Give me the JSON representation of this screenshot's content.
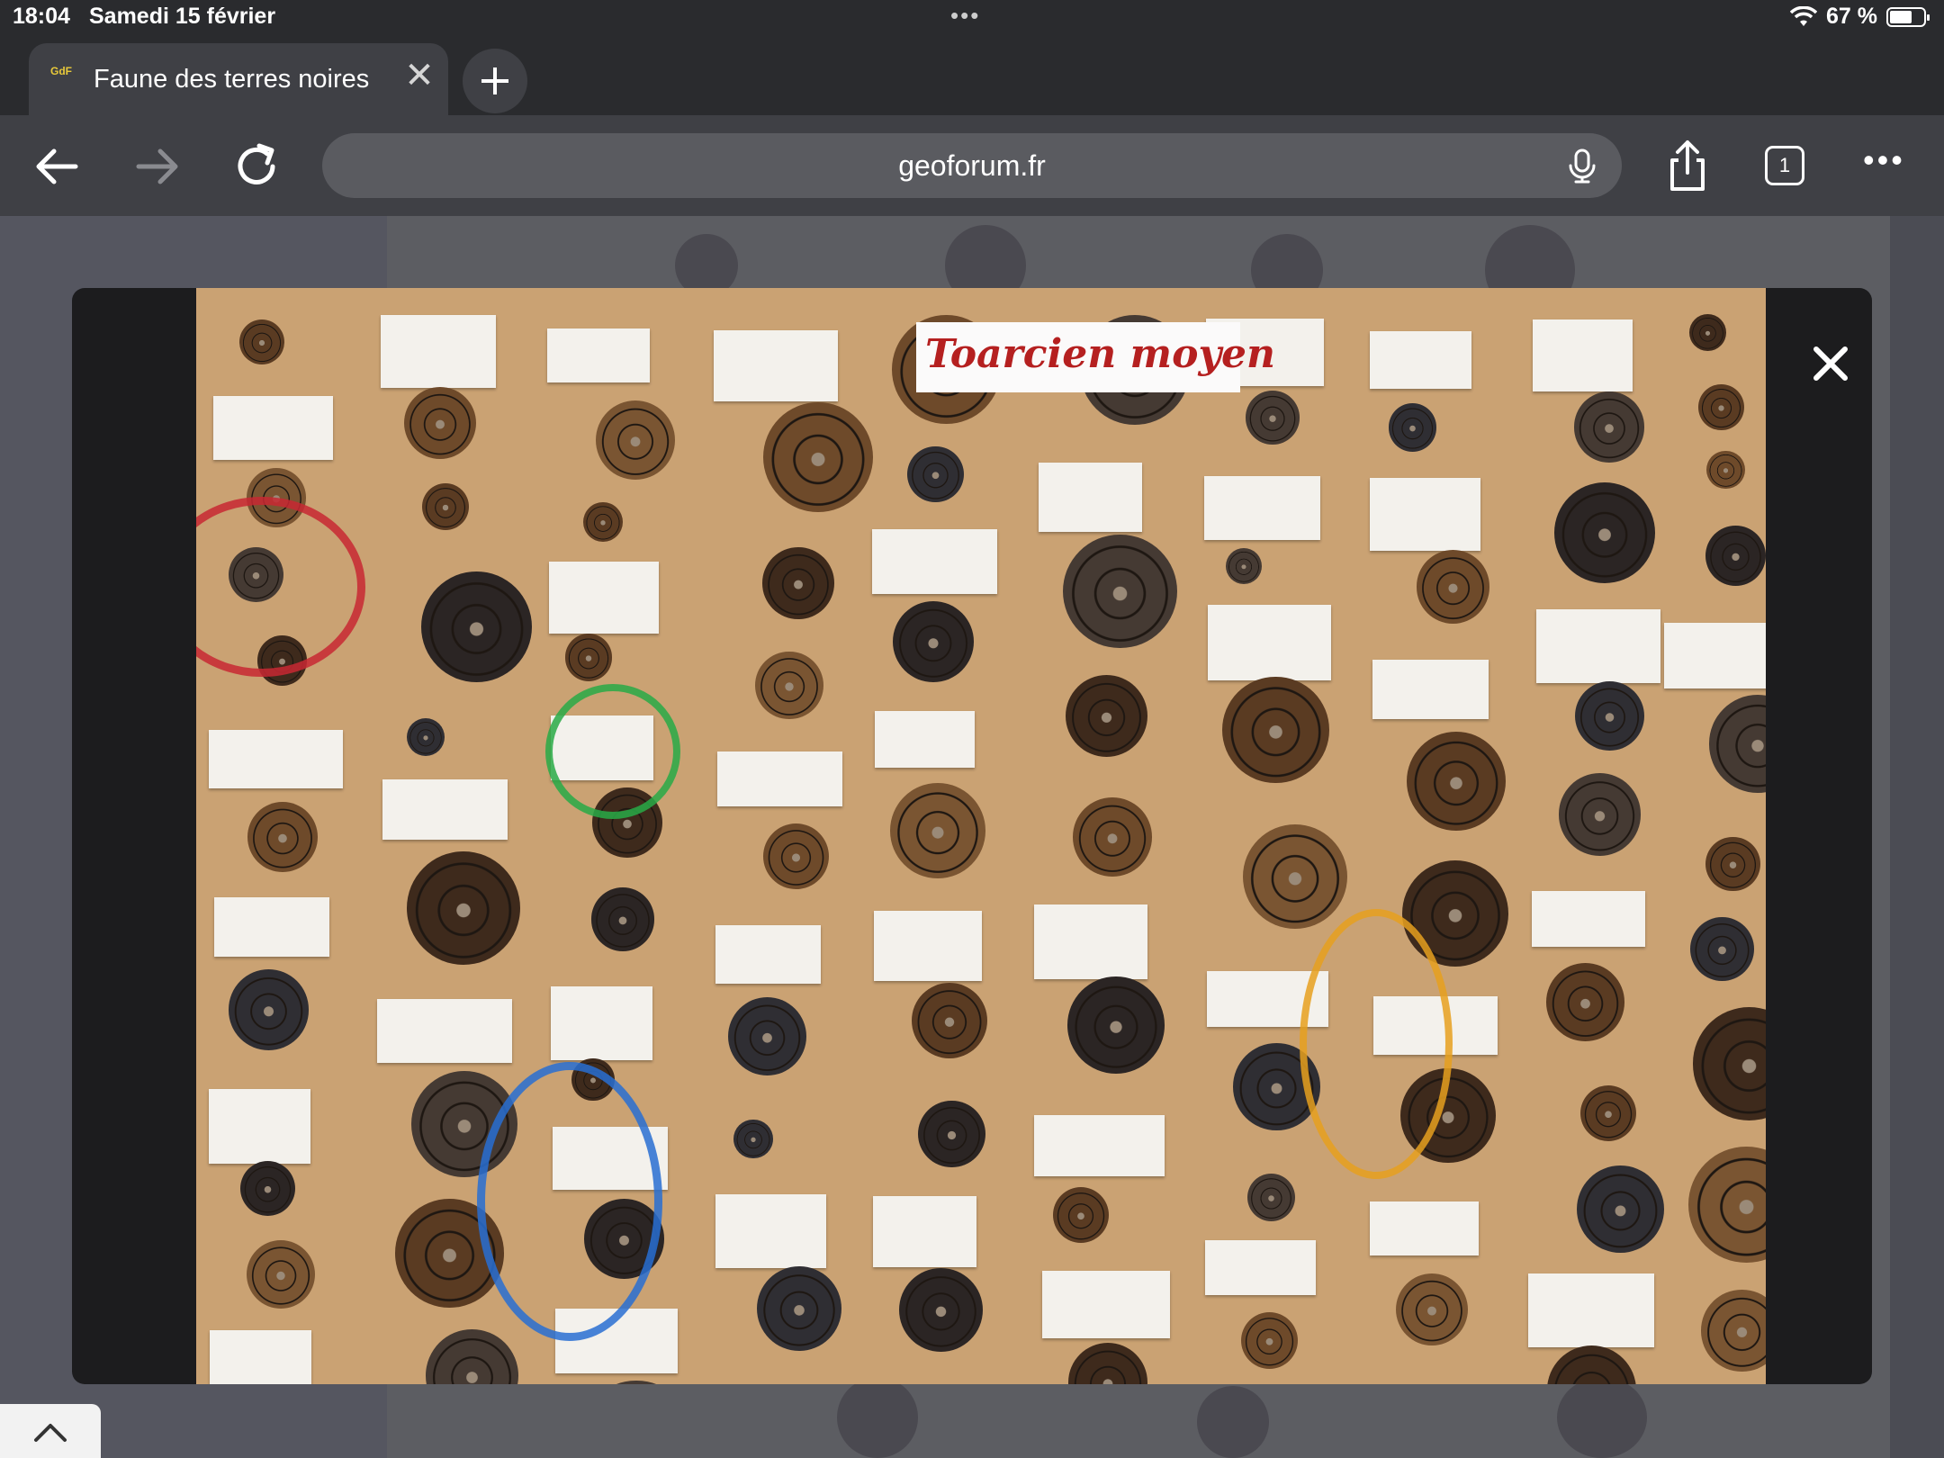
{
  "status": {
    "time": "18:04",
    "date": "Samedi 15 février",
    "battery": "67 %",
    "battery_level": 0.67
  },
  "tab": {
    "favicon": "GdF",
    "title": "Faune des terres noires"
  },
  "toolbar": {
    "url": "geoforum.fr",
    "tab_count": "1"
  },
  "image": {
    "title": "Toarcien moyen"
  },
  "icons": [
    "back-arrow-icon",
    "forward-arrow-icon",
    "reload-icon",
    "mic-icon",
    "share-icon",
    "tabs-icon",
    "more-icon",
    "close-icon",
    "chevron-up-icon",
    "wifi-icon",
    "battery-icon",
    "plus-icon"
  ]
}
